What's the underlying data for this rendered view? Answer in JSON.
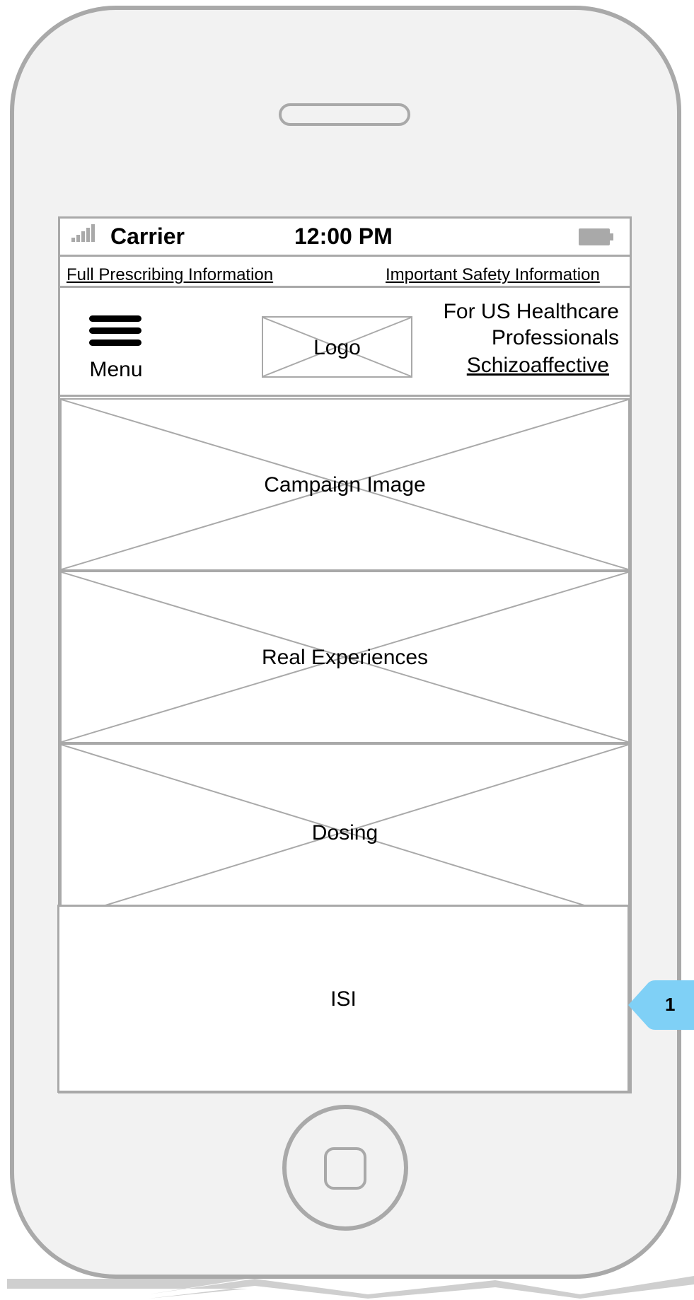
{
  "status_bar": {
    "carrier": "Carrier",
    "time": "12:00 PM"
  },
  "links": {
    "full_prescribing": "Full Prescribing Information",
    "important_safety": "Important Safety Information"
  },
  "header": {
    "menu_label": "Menu",
    "logo_label": "Logo",
    "audience_line1": "For US Healthcare",
    "audience_line2": "Professionals",
    "indication_link": "Schizoaffective"
  },
  "sections": {
    "campaign": "Campaign Image",
    "real_experiences": "Real Experiences",
    "dosing": "Dosing",
    "isi": "ISI"
  },
  "callout": {
    "number": "1"
  },
  "colors": {
    "wire": "#a9a9a9",
    "callout": "#7fd0f6",
    "phone_bg": "#f2f2f2"
  }
}
